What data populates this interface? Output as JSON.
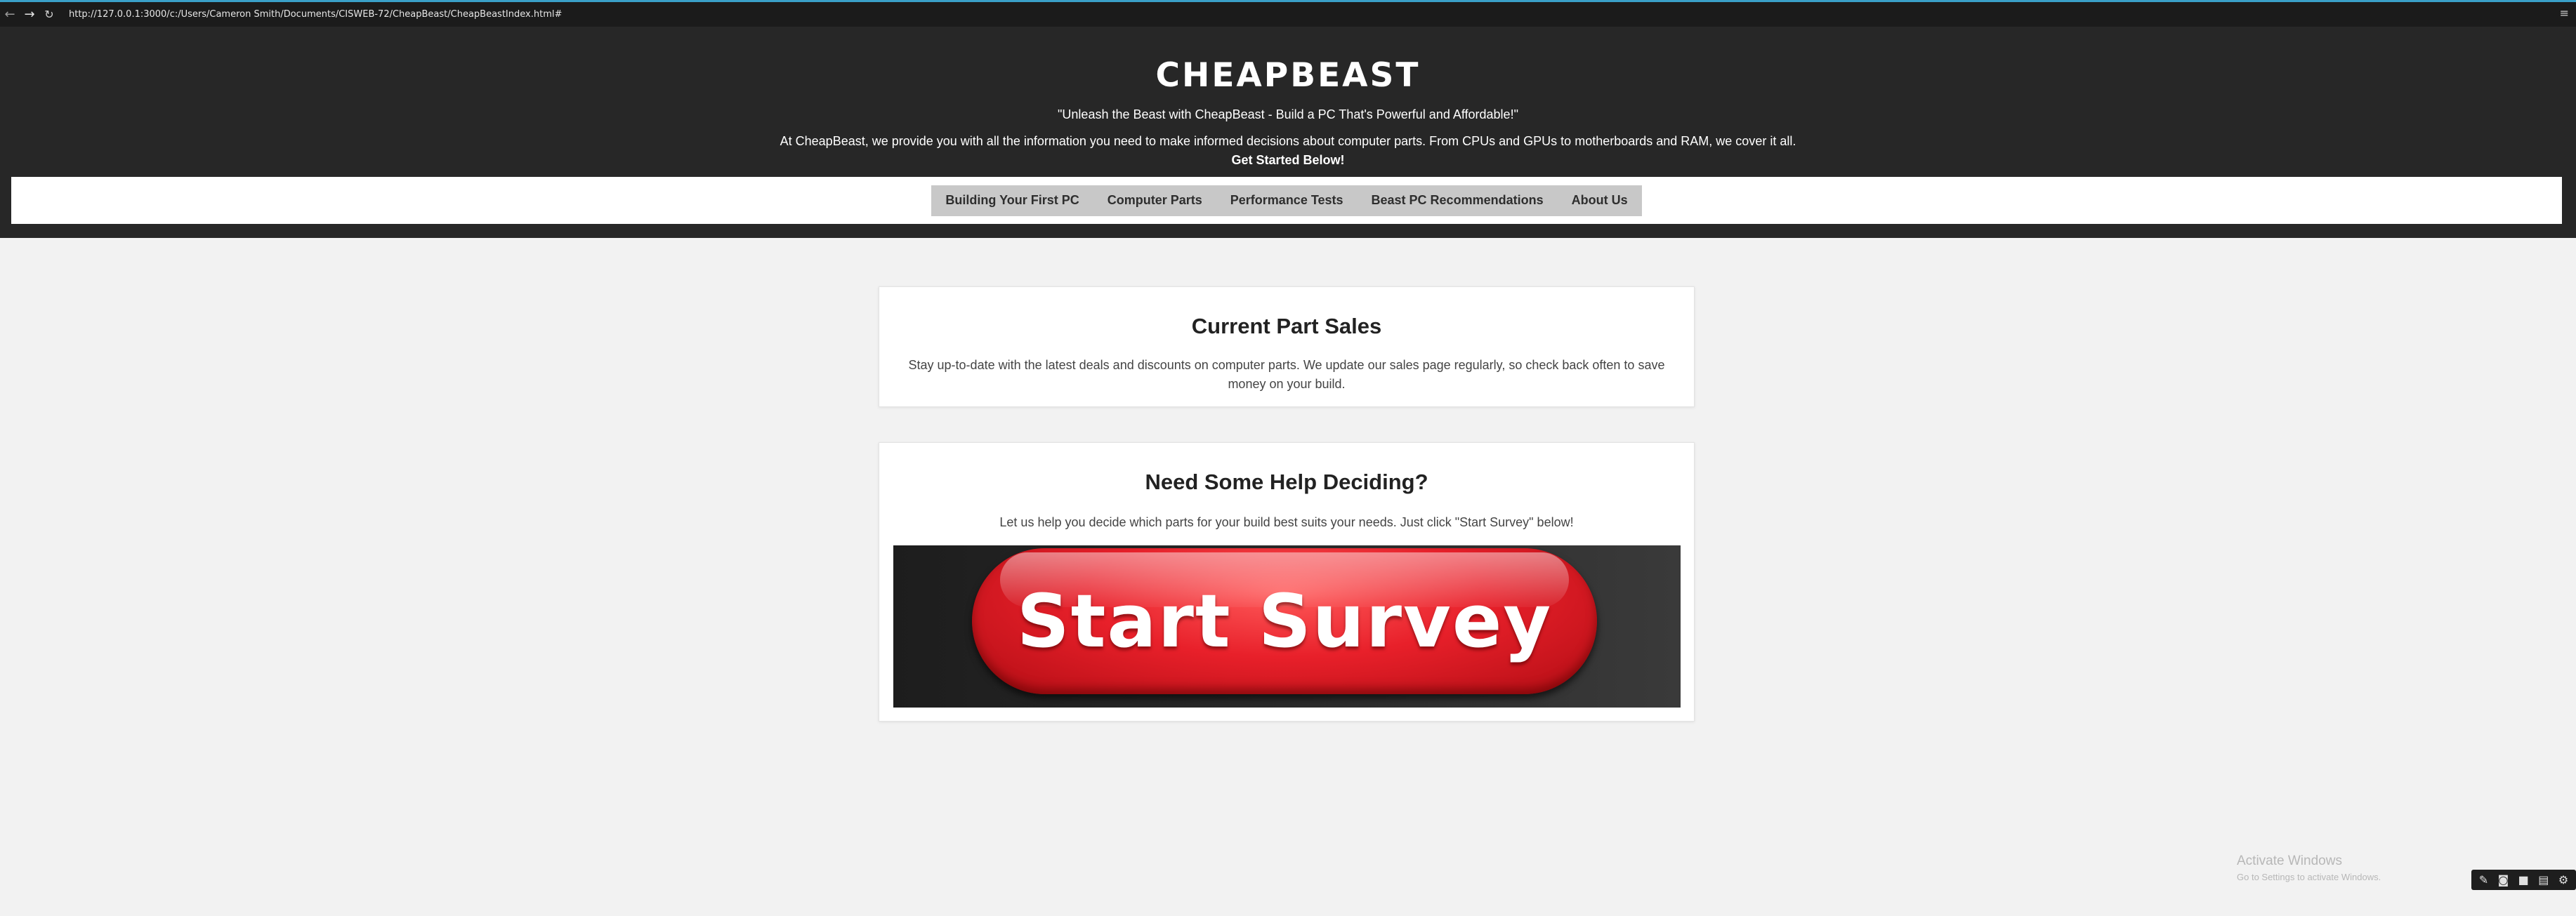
{
  "browser": {
    "back_icon": "←",
    "forward_icon": "→",
    "reload_icon": "↻",
    "url": "http://127.0.0.1:3000/c:/Users/Cameron Smith/Documents/CISWEB-72/CheapBeast/CheapBeastIndex.html#",
    "menu_icon": "≡"
  },
  "header": {
    "title": "CHEAPBEAST",
    "tagline": "\"Unleash the Beast with CheapBeast - Build a PC That's Powerful and Affordable!\"",
    "intro": "At CheapBeast, we provide you with all the information you need to make informed decisions about computer parts. From CPUs and GPUs to motherboards and RAM, we cover it all.",
    "cta": "Get Started Below!"
  },
  "nav": {
    "items": [
      {
        "label": "Building Your First PC"
      },
      {
        "label": "Computer Parts"
      },
      {
        "label": "Performance Tests"
      },
      {
        "label": "Beast PC Recommendations"
      },
      {
        "label": "About Us"
      }
    ]
  },
  "sales": {
    "title": "Current Part Sales",
    "text": "Stay up-to-date with the latest deals and discounts on computer parts. We update our sales page regularly, so check back often to save money on your build."
  },
  "help": {
    "title": "Need Some Help Deciding?",
    "text": "Let us help you decide which parts for your build best suits your needs. Just click \"Start Survey\" below!",
    "survey_button": "Start Survey"
  },
  "watermark": {
    "title": "Activate Windows",
    "subtitle": "Go to Settings to activate Windows."
  },
  "tray": {
    "icons": [
      "✎",
      "◙",
      "■",
      "▤",
      "⚙"
    ]
  },
  "colors": {
    "header_bg": "#272727",
    "page_bg": "#f2f2f2",
    "nav_bg": "#c8c8c8",
    "survey_red": "#e8202a"
  }
}
